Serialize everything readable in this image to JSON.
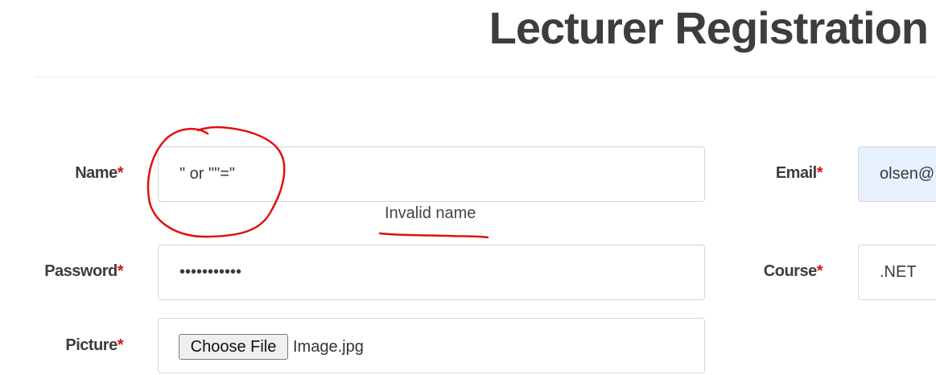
{
  "page": {
    "title": "Lecturer Registration"
  },
  "form": {
    "required_marker": "*",
    "name": {
      "label": "Name",
      "value": "\" or \"\"=\"",
      "error": "Invalid name"
    },
    "password": {
      "label": "Password",
      "value": "•••••••••••"
    },
    "picture": {
      "label": "Picture",
      "button_label": "Choose File",
      "file_name": "Image.jpg"
    },
    "email": {
      "label": "Email",
      "value": "olsen@"
    },
    "course": {
      "label": "Course",
      "value": ".NET"
    }
  },
  "annotations": {
    "color": "#e01010"
  }
}
